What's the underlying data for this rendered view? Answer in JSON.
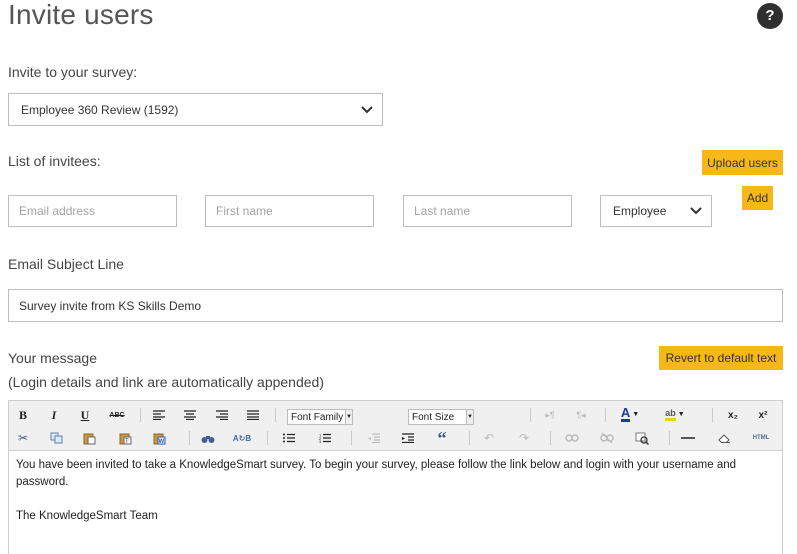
{
  "page": {
    "title": "Invite users",
    "help_label": "?"
  },
  "survey": {
    "label": "Invite to your survey:",
    "selected": "Employee 360 Review (1592)"
  },
  "invitees": {
    "label": "List of invitees:",
    "upload_label": "Upload users",
    "add_label": "Add",
    "email_placeholder": "Email address",
    "first_name_placeholder": "First name",
    "last_name_placeholder": "Last name",
    "role_selected": "Employee"
  },
  "subject": {
    "label": "Email Subject Line",
    "value": "Survey invite from KS Skills Demo"
  },
  "message": {
    "label": "Your message",
    "note": "(Login details and link are automatically appended)",
    "revert_label": "Revert to default text",
    "line1": "You have been invited to take a KnowledgeSmart survey. To begin your survey, please follow the link below and login with your username and",
    "line2": "password.",
    "signature": "The KnowledgeSmart Team"
  },
  "toolbar": {
    "bold": "B",
    "italic": "I",
    "underline": "U",
    "strikethrough": "ABC",
    "font_family": "Font Family",
    "font_size": "Font Size",
    "subscript": "x₂",
    "superscript": "x²",
    "html": "HTML",
    "quote": "“"
  },
  "colors": {
    "accent": "#f7b718",
    "help_bg": "#2f2f2f",
    "toolbar_bg": "#f0f0f0"
  }
}
